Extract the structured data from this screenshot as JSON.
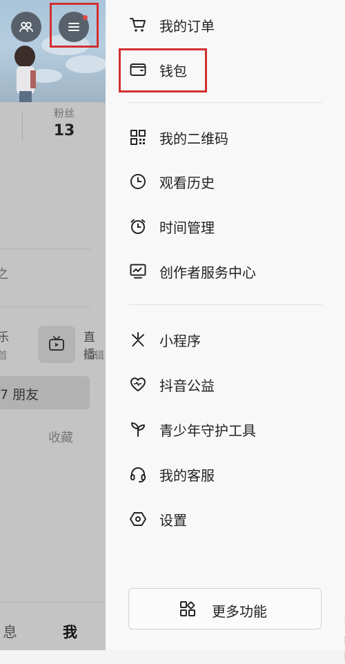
{
  "profile": {
    "followers_label": "粉丝",
    "followers_count": "13",
    "frag_1": "之",
    "frag_2": "乐",
    "frag_3": "首",
    "live_label": "直播",
    "edit_label": "编辑",
    "friends_label": "7 朋友",
    "favorites_tab": "收藏",
    "nav_messages": "息",
    "nav_me": "我"
  },
  "drawer": {
    "group1": [
      {
        "label": "我的订单",
        "icon": "cart-icon"
      },
      {
        "label": "钱包",
        "icon": "wallet-icon"
      }
    ],
    "group2": [
      {
        "label": "我的二维码",
        "icon": "qrcode-icon"
      },
      {
        "label": "观看历史",
        "icon": "clock-icon"
      },
      {
        "label": "时间管理",
        "icon": "alarm-icon"
      },
      {
        "label": "创作者服务中心",
        "icon": "chart-icon"
      }
    ],
    "group3": [
      {
        "label": "小程序",
        "icon": "asterisk-icon"
      },
      {
        "label": "抖音公益",
        "icon": "heart-icon"
      },
      {
        "label": "青少年守护工具",
        "icon": "sprout-icon"
      },
      {
        "label": "我的客服",
        "icon": "headset-icon"
      },
      {
        "label": "设置",
        "icon": "settings-hex-icon"
      }
    ],
    "more_button": "更多功能"
  },
  "colors": {
    "highlight_box": "#d22e2e",
    "notification_dot": "#e2453f"
  }
}
